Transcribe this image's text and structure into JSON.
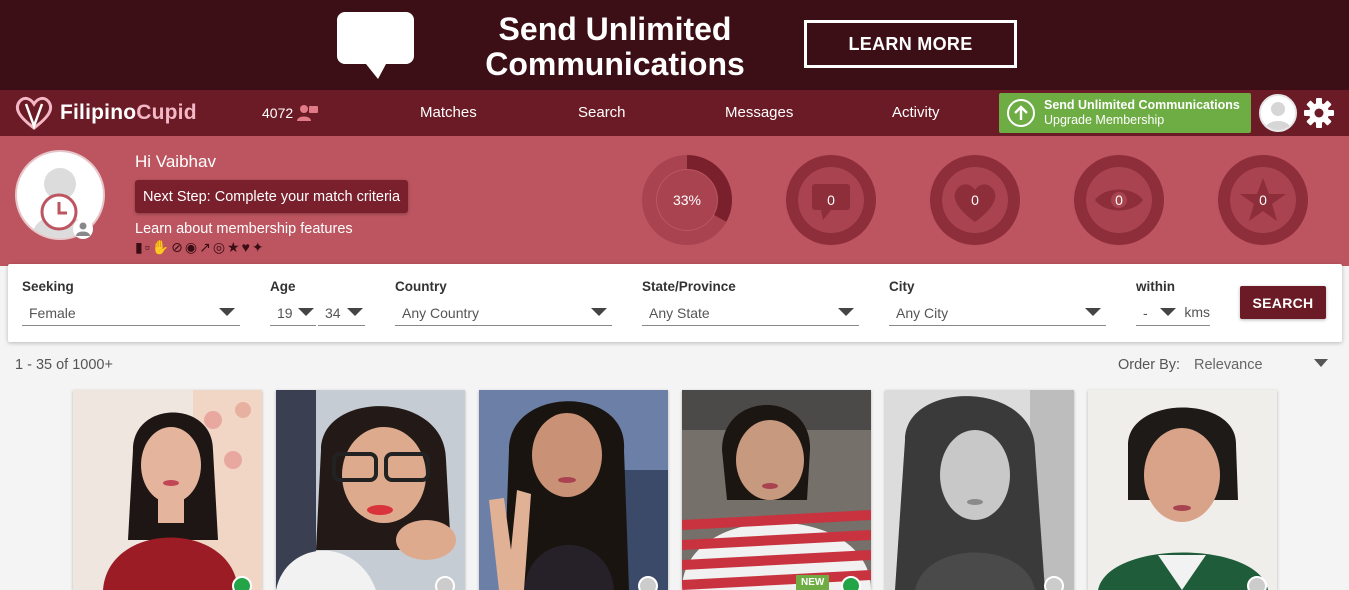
{
  "banner": {
    "headline_line1": "Send Unlimited",
    "headline_line2": "Communications",
    "cta": "LEARN MORE",
    "bg_color": "#3c0f16"
  },
  "nav": {
    "logo": "FilipinoCupid",
    "count": "4072",
    "items": [
      "Matches",
      "Search",
      "Messages",
      "Activity"
    ],
    "upgrade_title": "Send Unlimited Communications",
    "upgrade_sub": "Upgrade Membership",
    "bg_color": "#6b1b25",
    "upgrade_color": "#6eac44"
  },
  "profile": {
    "greeting": "Hi Vaibhav",
    "next_step": "Next Step: Complete your match criteria",
    "learn": "Learn about membership features",
    "feature_icons": [
      "chat-icon",
      "unlock-icon",
      "hand-icon",
      "hide-icon",
      "rating-icon",
      "trend-icon",
      "x2-icon",
      "star-icon",
      "hearts-icon",
      "magic-wand-icon"
    ],
    "stats": [
      {
        "name": "profile-complete",
        "value": "33%",
        "progress": 0.33
      },
      {
        "name": "messages",
        "value": "0"
      },
      {
        "name": "favorites",
        "value": "0"
      },
      {
        "name": "views",
        "value": "0"
      },
      {
        "name": "interests",
        "value": "0"
      }
    ],
    "bg_color": "#bd5560"
  },
  "filters": {
    "seeking_label": "Seeking",
    "seeking_value": "Female",
    "age_label": "Age",
    "age_min": "19",
    "age_max": "34",
    "country_label": "Country",
    "country_value": "Any Country",
    "state_label": "State/Province",
    "state_value": "Any State",
    "city_label": "City",
    "city_value": "Any City",
    "within_label": "within",
    "within_value": "-",
    "within_unit": "kms",
    "search_button": "SEARCH"
  },
  "results": {
    "count_text": "1 - 35 of 1000+",
    "order_label": "Order By:",
    "order_value": "Relevance"
  },
  "cards": [
    {
      "status": "online",
      "status_color": "#22a447",
      "badge": ""
    },
    {
      "status": "offline",
      "status_color": "#cccccc",
      "badge": ""
    },
    {
      "status": "offline",
      "status_color": "#cccccc",
      "badge": ""
    },
    {
      "status": "online",
      "status_color": "#22a447",
      "badge": "NEW"
    },
    {
      "status": "offline",
      "status_color": "#cccccc",
      "badge": ""
    },
    {
      "status": "offline",
      "status_color": "#cccccc",
      "badge": ""
    }
  ]
}
